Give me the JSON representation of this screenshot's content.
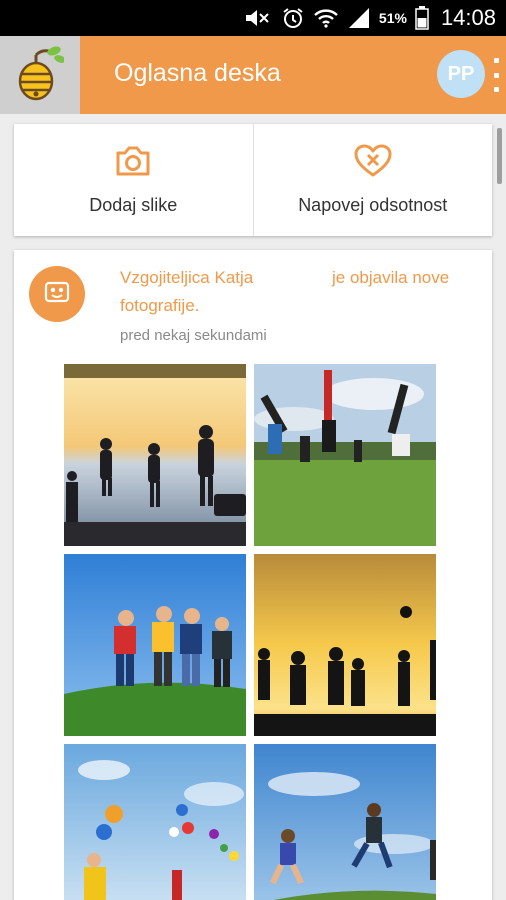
{
  "status_bar": {
    "battery_percent": "51%",
    "time": "14:08",
    "icons": [
      "mute-icon",
      "alarm-icon",
      "wifi-icon",
      "signal-icon",
      "battery-icon"
    ]
  },
  "app_bar": {
    "logo_icon": "beehive-icon",
    "title": "Oglasna deska",
    "avatar_initials": "PP",
    "brand_color": "#f0994a"
  },
  "actions": [
    {
      "label": "Dodaj slike",
      "icon": "camera-icon"
    },
    {
      "label": "Napovej odsotnost",
      "icon": "heart-x-icon"
    }
  ],
  "post": {
    "author": "Vzgojiteljica Katja",
    "action_part1": "je objavila nove",
    "action_part2": "fotografije.",
    "time": "pred nekaj sekundami",
    "avatar_icon": "photo-icon",
    "photos": [
      {
        "name": "children-at-lake-sunset"
      },
      {
        "name": "children-cartwheels-on-grass"
      },
      {
        "name": "children-circle-dance"
      },
      {
        "name": "children-silhouettes-ball-sunset"
      },
      {
        "name": "child-with-balloons"
      },
      {
        "name": "children-jumping-sky"
      }
    ]
  }
}
